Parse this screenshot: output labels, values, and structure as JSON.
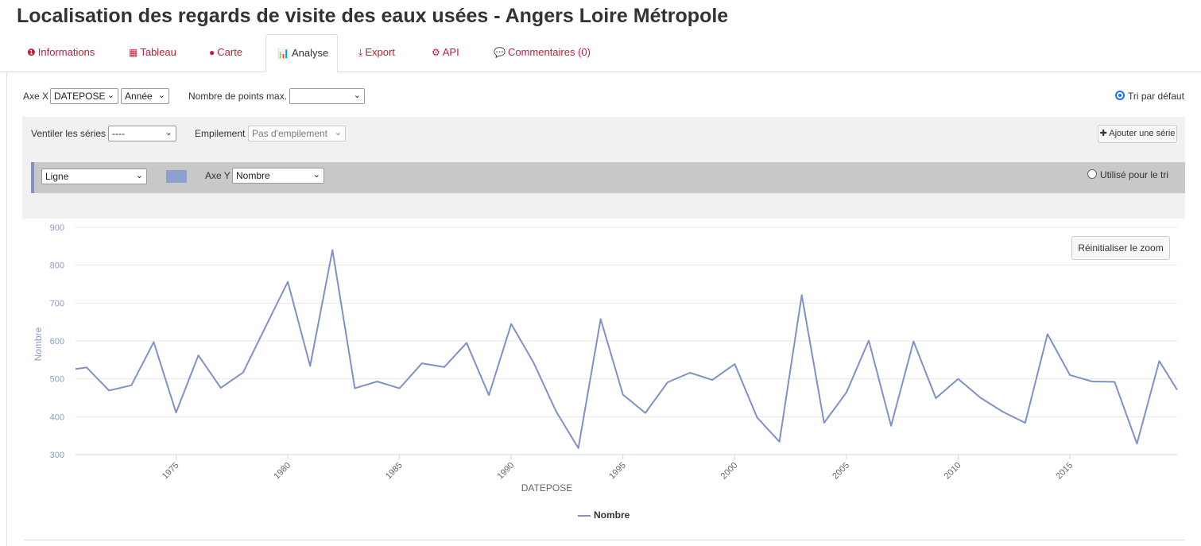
{
  "page": {
    "title": "Localisation des regards de visite des eaux usées - Angers Loire Métropole"
  },
  "tabs": [
    {
      "icon": "info-circle-icon",
      "glyph": "❶",
      "label": "Informations"
    },
    {
      "icon": "table-icon",
      "glyph": "▦",
      "label": "Tableau"
    },
    {
      "icon": "globe-icon",
      "glyph": "●",
      "label": "Carte"
    },
    {
      "icon": "bar-chart-icon",
      "glyph": "📊",
      "label": "Analyse"
    },
    {
      "icon": "download-icon",
      "glyph": "⤓",
      "label": "Export"
    },
    {
      "icon": "cogs-icon",
      "glyph": "⚙",
      "label": "API"
    },
    {
      "icon": "comments-icon",
      "glyph": "💬",
      "label": "Commentaires (0)"
    }
  ],
  "controls": {
    "axe_x_label": "Axe X",
    "axe_x_value": "DATEPOSE",
    "axe_x_granularity": "Année",
    "max_points_label": "Nombre de points max.",
    "max_points_value": "",
    "sort_default_label": "Tri par défaut",
    "ventiler_label": "Ventiler les séries",
    "ventiler_value": "----",
    "empilement_label": "Empilement",
    "empilement_value": "Pas d'empilement",
    "add_series_label": "Ajouter une série",
    "series_type": "Ligne",
    "axe_y_label": "Axe Y",
    "axe_y_value": "Nombre",
    "used_for_sort_label": "Utilisé pour le tri",
    "reset_zoom_label": "Réinitialiser le zoom",
    "chevron": "⌄",
    "plus": "✚"
  },
  "colors": {
    "accent": "#b8223e",
    "series": "#7f91c6",
    "active_radio": "#1a73e8"
  },
  "chart_data": {
    "type": "line",
    "xlabel": "DATEPOSE",
    "ylabel": "Nombre",
    "ylim": [
      300,
      900
    ],
    "xlim": [
      1970.5,
      2019.8
    ],
    "yticks": [
      300,
      400,
      500,
      600,
      700,
      800,
      900
    ],
    "xticks": [
      1975,
      1980,
      1985,
      1990,
      1995,
      2000,
      2005,
      2010,
      2015
    ],
    "grid": true,
    "legend": "bottom-center",
    "series": [
      {
        "name": "Nombre",
        "x": [
          1970.5,
          1971,
          1972,
          1973,
          1974,
          1975,
          1976,
          1977,
          1978,
          1979,
          1980,
          1981,
          1982,
          1983,
          1984,
          1985,
          1986,
          1987,
          1988,
          1989,
          1990,
          1991,
          1992,
          1993,
          1994,
          1995,
          1996,
          1997,
          1998,
          1999,
          2000,
          2001,
          2002,
          2003,
          2004,
          2005,
          2006,
          2007,
          2008,
          2009,
          2010,
          2011,
          2012,
          2013,
          2014,
          2015,
          2016,
          2017,
          2018,
          2019,
          2019.8
        ],
        "values": [
          526,
          530,
          469,
          483,
          597,
          411,
          562,
          476,
          517,
          637,
          756,
          534,
          840,
          475,
          493,
          475,
          541,
          531,
          595,
          457,
          645,
          543,
          415,
          317,
          658,
          458,
          410,
          491,
          516,
          497,
          539,
          398,
          334,
          721,
          384,
          464,
          601,
          376,
          599,
          449,
          500,
          450,
          413,
          384,
          618,
          510,
          493,
          492,
          329,
          547,
          471
        ]
      }
    ]
  }
}
